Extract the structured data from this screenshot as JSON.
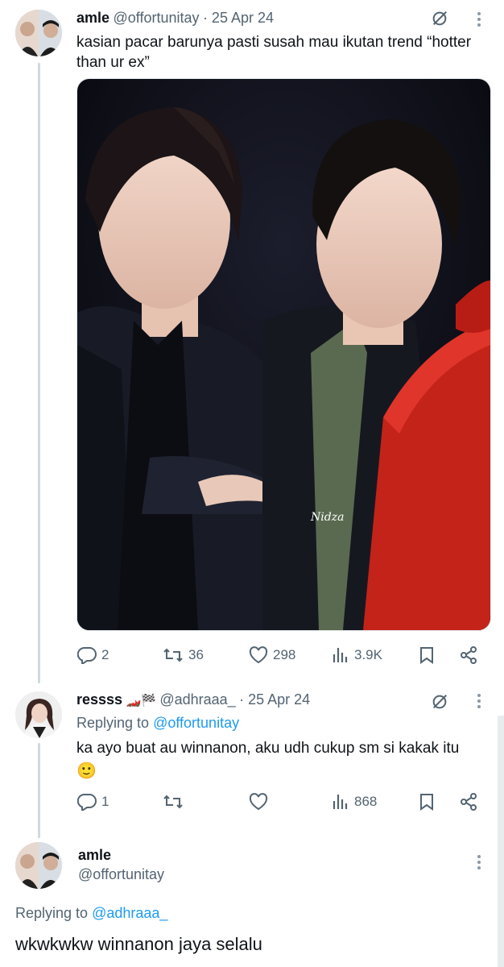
{
  "tweet1": {
    "display_name": "amle",
    "handle": "@offortunitay",
    "date": "· 25 Apr 24",
    "text": "kasian pacar barunya pasti susah mau ikutan trend “hotter than ur ex”",
    "image_watermark": "Nidza",
    "stats": {
      "replies": "2",
      "retweets": "36",
      "likes": "298",
      "views": "3.9K"
    }
  },
  "tweet2": {
    "display_name": "ressss",
    "name_emojis": "🏎️🏁",
    "handle": "@adhraaa_",
    "date": "· 25 Apr 24",
    "replying_prefix": "Replying to",
    "replying_to": "@offortunitay",
    "text": "ka ayo buat au winnanon, aku udh cukup sm si kakak itu",
    "emoji": "🙂",
    "stats": {
      "replies": "1",
      "retweets": "",
      "likes": "",
      "views": "868"
    }
  },
  "tweet3": {
    "display_name": "amle",
    "handle": "@offortunitay",
    "replying_prefix": "Replying to",
    "replying_to": "@adhraaa_",
    "text": "wkwkwkw winnanon jaya selalu"
  },
  "icons": [
    "reply-icon",
    "retweet-icon",
    "like-icon",
    "views-icon",
    "bookmark-icon",
    "share-icon",
    "grok-icon",
    "more-icon"
  ],
  "colors": {
    "link": "#1d9bf0",
    "muted": "#536471",
    "thread_line": "#cfd9de"
  }
}
